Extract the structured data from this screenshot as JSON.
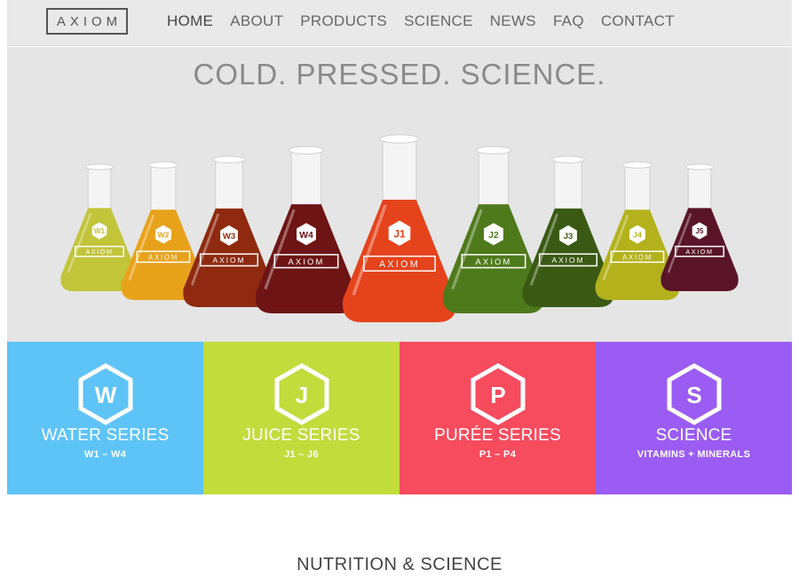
{
  "brand": {
    "logo_text": "AXIOM"
  },
  "nav": {
    "items": [
      {
        "label": "HOME"
      },
      {
        "label": "ABOUT"
      },
      {
        "label": "PRODUCTS"
      },
      {
        "label": "SCIENCE"
      },
      {
        "label": "NEWS"
      },
      {
        "label": "FAQ"
      },
      {
        "label": "CONTACT"
      }
    ]
  },
  "hero": {
    "title": "COLD. PRESSED. SCIENCE.",
    "bottles": [
      {
        "code": "W1",
        "color": "#c2c43a",
        "brand": "AXIOM"
      },
      {
        "code": "W2",
        "color": "#e8a21a",
        "brand": "AXIOM"
      },
      {
        "code": "W3",
        "color": "#8f2a10",
        "brand": "AXIOM"
      },
      {
        "code": "W4",
        "color": "#6e1414",
        "brand": "AXIOM"
      },
      {
        "code": "J1",
        "color": "#e5431c",
        "brand": "AXIOM"
      },
      {
        "code": "J2",
        "color": "#4f7a1c",
        "brand": "AXIOM"
      },
      {
        "code": "J3",
        "color": "#3a5a14",
        "brand": "AXIOM"
      },
      {
        "code": "J4",
        "color": "#b3b21c",
        "brand": "AXIOM"
      },
      {
        "code": "J5",
        "color": "#5a1428",
        "brand": "AXIOM"
      }
    ]
  },
  "tiles": [
    {
      "letter": "W",
      "title": "WATER SERIES",
      "subtitle": "W1 – W4",
      "color": "#5ec4f7"
    },
    {
      "letter": "J",
      "title": "JUICE SERIES",
      "subtitle": "J1 – J6",
      "color": "#c2dc3c"
    },
    {
      "letter": "P",
      "title": "PURÉE SERIES",
      "subtitle": "P1 – P4",
      "color": "#f74b5e"
    },
    {
      "letter": "S",
      "title": "SCIENCE",
      "subtitle": "VITAMINS + MINERALS",
      "color": "#9a5cf2"
    }
  ],
  "section": {
    "title": "NUTRITION & SCIENCE"
  }
}
